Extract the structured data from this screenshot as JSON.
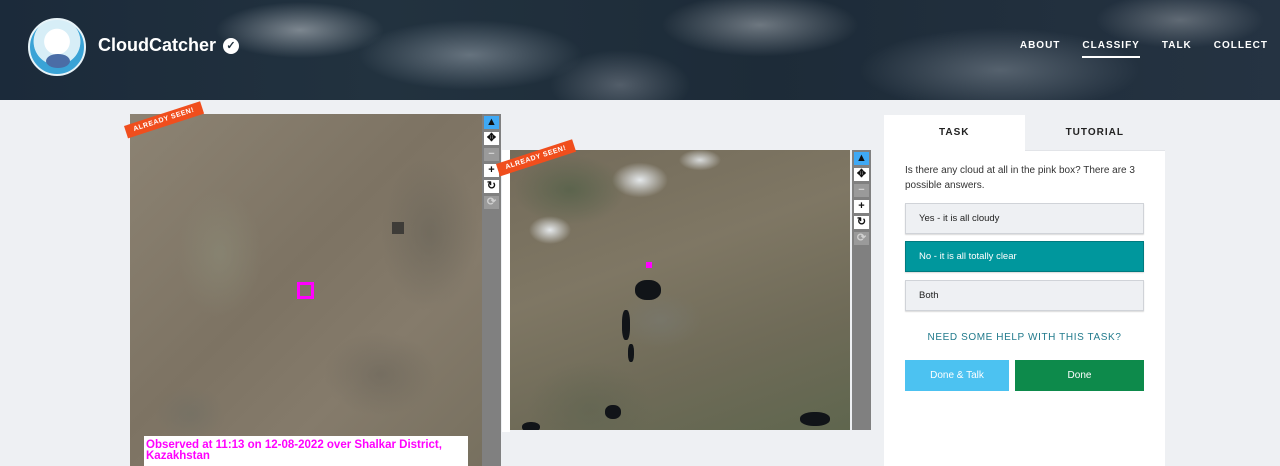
{
  "header": {
    "brand": "CloudCatcher",
    "nav": [
      {
        "label": "ABOUT"
      },
      {
        "label": "CLASSIFY",
        "active": true
      },
      {
        "label": "TALK"
      },
      {
        "label": "COLLECT"
      }
    ]
  },
  "subject": {
    "ribbon_1": "ALREADY SEEN!",
    "ribbon_2": "ALREADY SEEN!",
    "caption": "Observed at 11:13 on 12-08-2022 over Shalkar District, Kazakhstan",
    "tools": [
      {
        "icon": "pointer-icon",
        "glyph": "▲"
      },
      {
        "icon": "move-icon",
        "glyph": "✥"
      },
      {
        "icon": "zoom-out-icon",
        "glyph": "−"
      },
      {
        "icon": "zoom-in-icon",
        "glyph": "+"
      },
      {
        "icon": "rotate-icon",
        "glyph": "↻"
      },
      {
        "icon": "reset-icon",
        "glyph": "⟳"
      }
    ],
    "highlight_color": "#ff00ff"
  },
  "task": {
    "tabs": [
      {
        "label": "TASK"
      },
      {
        "label": "TUTORIAL"
      }
    ],
    "question": "Is there any cloud at all in the pink box? There are 3 possible answers.",
    "answers": [
      {
        "label": "Yes - it is all cloudy"
      },
      {
        "label": "No - it is all totally clear",
        "selected": true
      },
      {
        "label": "Both"
      }
    ],
    "help": "NEED SOME HELP WITH THIS TASK?",
    "done_talk": "Done & Talk",
    "done": "Done",
    "colors": {
      "selected": "#00979d",
      "done_talk": "#4cc2f1",
      "done": "#0d8a4b"
    }
  }
}
